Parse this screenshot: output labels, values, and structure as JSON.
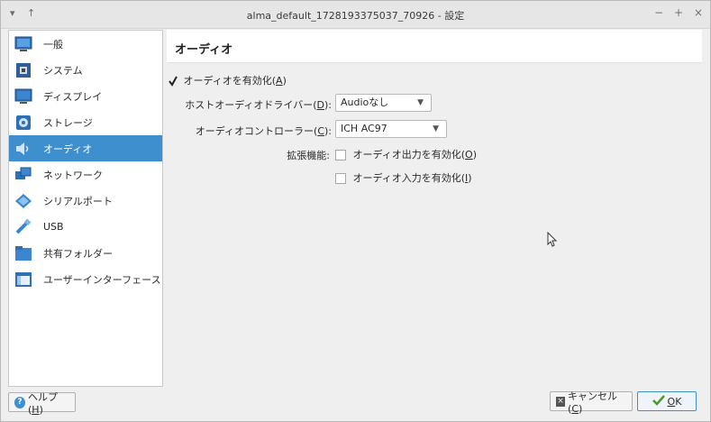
{
  "window": {
    "title": "alma_default_1728193375037_70926 - 設定",
    "left_controls": [
      "▾",
      "↑"
    ],
    "right_controls": [
      "−",
      "+",
      "×"
    ]
  },
  "sidebar": {
    "items": [
      {
        "label": "一般",
        "icon": "general-icon"
      },
      {
        "label": "システム",
        "icon": "system-icon"
      },
      {
        "label": "ディスプレイ",
        "icon": "display-icon"
      },
      {
        "label": "ストレージ",
        "icon": "storage-icon"
      },
      {
        "label": "オーディオ",
        "icon": "audio-icon",
        "active": true
      },
      {
        "label": "ネットワーク",
        "icon": "network-icon"
      },
      {
        "label": "シリアルポート",
        "icon": "serial-port-icon"
      },
      {
        "label": "USB",
        "icon": "usb-icon"
      },
      {
        "label": "共有フォルダー",
        "icon": "shared-folder-icon"
      },
      {
        "label": "ユーザーインターフェース",
        "icon": "user-interface-icon"
      }
    ]
  },
  "page": {
    "title": "オーディオ",
    "enable_audio": {
      "label": "オーディオを有効化(",
      "mnemonic": "A",
      "suffix": ")",
      "checked": true
    },
    "host_driver": {
      "label": "ホストオーディオドライバー(",
      "mnemonic": "D",
      "suffix": "):",
      "value": "Audioなし"
    },
    "controller": {
      "label": "オーディオコントローラー(",
      "mnemonic": "C",
      "suffix": "):",
      "value": "ICH AC97"
    },
    "extended": {
      "label": "拡張機能:",
      "output": {
        "label": "オーディオ出力を有効化(",
        "mnemonic": "O",
        "suffix": ")",
        "checked": false
      },
      "input": {
        "label": "オーディオ入力を有効化(",
        "mnemonic": "I",
        "suffix": ")",
        "checked": false
      }
    }
  },
  "footer": {
    "help": {
      "label": "ヘルプ(",
      "mnemonic": "H",
      "suffix": ")"
    },
    "cancel": {
      "label": "キャンセル(",
      "mnemonic": "C",
      "suffix": ")"
    },
    "ok": {
      "label": "",
      "mnemonic": "O",
      "suffix": "K"
    }
  },
  "colors": {
    "accent": "#3d90cd",
    "window_bg": "#efefef"
  }
}
